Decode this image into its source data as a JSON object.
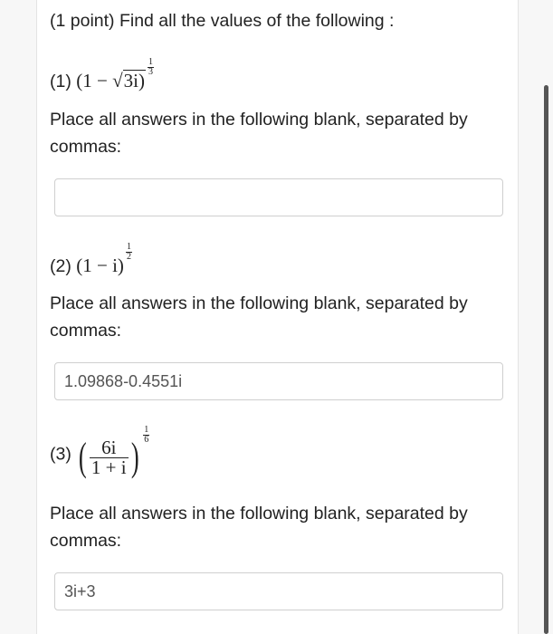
{
  "problem": {
    "header": "(1 point) Find all the values of the following :",
    "instruction_line1": "Place all answers in the following blank, separated by",
    "instruction_line2": "commas:"
  },
  "parts": [
    {
      "label": "(1)",
      "expression": {
        "open": "(1 −",
        "sqrt_arg": "3",
        "after_sqrt": "i)",
        "exp_num": "1",
        "exp_den": "3"
      },
      "answer_value": "",
      "answer_placeholder": ""
    },
    {
      "label": "(2)",
      "expression": {
        "base": "(1 − i)",
        "exp_num": "1",
        "exp_den": "2"
      },
      "answer_value": "1.09868-0.4551i",
      "answer_placeholder": ""
    },
    {
      "label": "(3)",
      "expression": {
        "open_paren": "(",
        "num": "6i",
        "den": "1 + i",
        "close_paren": ")",
        "exp_num": "1",
        "exp_den": "6"
      },
      "answer_value": "3i+3",
      "answer_placeholder": ""
    }
  ]
}
